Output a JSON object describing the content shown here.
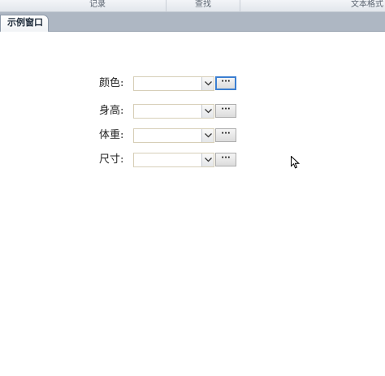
{
  "ribbon": {
    "groups": [
      "记录",
      "查找",
      "文本格式"
    ]
  },
  "tabs": [
    {
      "label": "示例窗口",
      "active": true
    }
  ],
  "form": {
    "fields": [
      {
        "label": "颜色:",
        "value": "",
        "button_label": "···",
        "focused": true
      },
      {
        "label": "身高:",
        "value": "",
        "button_label": "···",
        "focused": false
      },
      {
        "label": "体重:",
        "value": "",
        "button_label": "···",
        "focused": false
      },
      {
        "label": "尺寸:",
        "value": "",
        "button_label": "···",
        "focused": false
      }
    ]
  },
  "colors": {
    "tabstrip": "#aeb7c3",
    "focus_border": "#3c7fd1",
    "combo_border": "#d7cfb8"
  },
  "icons": {
    "dropdown": "chevron-down-icon",
    "cursor": "mouse-pointer-icon"
  }
}
